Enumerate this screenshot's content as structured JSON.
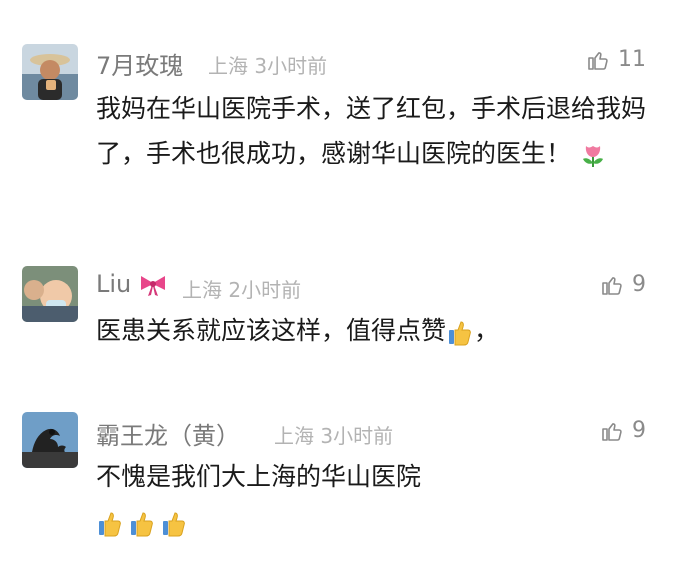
{
  "comments": [
    {
      "user": "7月玫瑰",
      "location": "上海",
      "time": "3小时前",
      "likes": "11",
      "text": "我妈在华山医院手术，送了红包，手术后退给我妈了，手术也很成功，感谢华山医院的医生！",
      "emoji": "tulip-emoji"
    },
    {
      "user": "Liu",
      "location": "上海",
      "time": "2小时前",
      "likes": "9",
      "text": "医患关系就应该这样，值得点赞",
      "text_tail": "，",
      "emoji": "thumbs-up-emoji"
    },
    {
      "user": "霸王龙（黄）",
      "location": "上海",
      "time": "3小时前",
      "likes": "9",
      "text": "不愧是我们大上海的华山医院",
      "emoji": "thumbs-up-emoji"
    }
  ]
}
